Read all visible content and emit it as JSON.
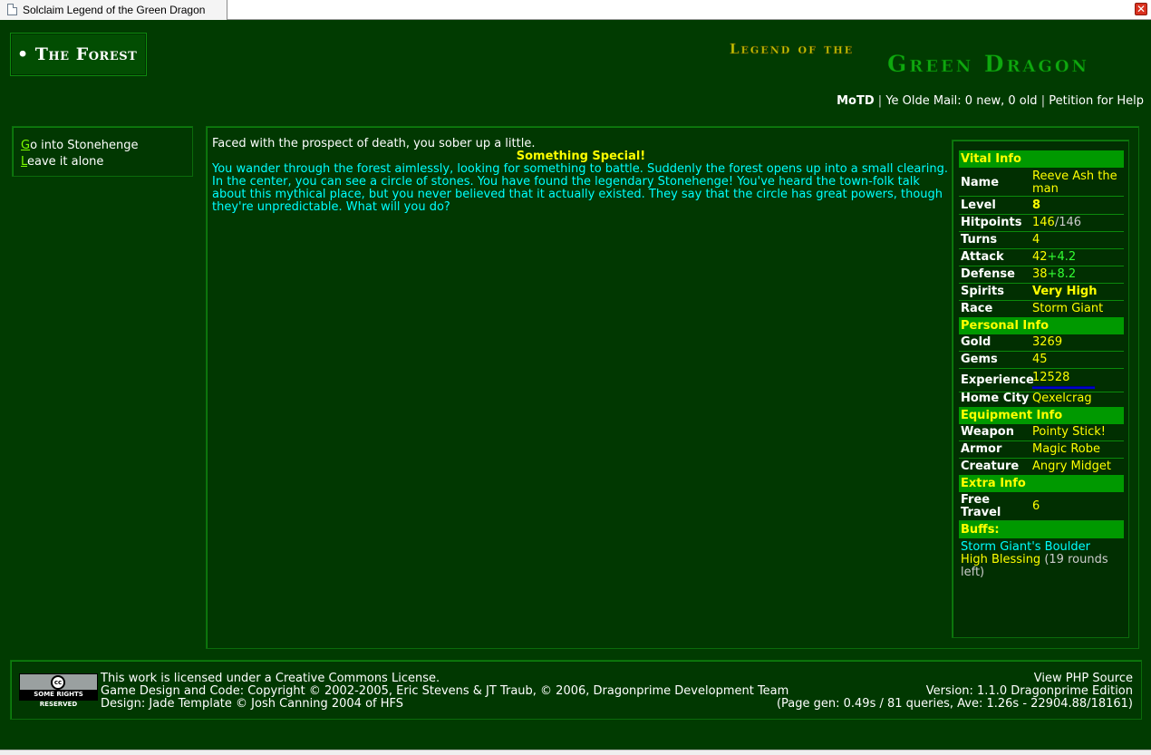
{
  "window": {
    "tab_title": "Solclaim Legend of the Green Dragon",
    "close_glyph": "✕"
  },
  "header": {
    "page_title": "• The Forest",
    "logo_text_small": "Legend of the",
    "logo_text_large": "Green Dragon",
    "logo_colors": {
      "small": "#c8c800",
      "large": "#0fa80f"
    }
  },
  "topnav": {
    "motd": "MoTD",
    "sep": "|",
    "mail": "Ye Olde Mail: 0 new, 0 old",
    "petition": "Petition for Help"
  },
  "nav": {
    "items": [
      {
        "hotkey": "G",
        "rest": "o into Stonehenge"
      },
      {
        "hotkey": "L",
        "rest": "eave it alone"
      }
    ]
  },
  "content": {
    "intro": "Faced with the prospect of death, you sober up a little.",
    "special_heading": "Something Special!",
    "story": "You wander through the forest aimlessly, looking for something to battle. Suddenly the forest opens up into a small clearing. In the center, you can see a circle of stones. You have found the legendary Stonehenge! You've heard the town-folk talk about this mythical place, but you never believed that it actually existed. They say that the circle has great powers, though they're unpredictable. What will you do?"
  },
  "stats": {
    "vital_head": "Vital Info",
    "name_label": "Name",
    "name_value": "Reeve Ash the man",
    "level_label": "Level",
    "level_value": "8",
    "hitpoints_label": "Hitpoints",
    "hp_current": "146",
    "hp_slash": "/",
    "hp_max": "146",
    "turns_label": "Turns",
    "turns_value": "4",
    "attack_label": "Attack",
    "attack_base": "42",
    "attack_bonus": "+4.2",
    "defense_label": "Defense",
    "defense_base": "38",
    "defense_bonus": "+8.2",
    "spirits_label": "Spirits",
    "spirits_value": "Very High",
    "race_label": "Race",
    "race_value": "Storm Giant",
    "personal_head": "Personal Info",
    "gold_label": "Gold",
    "gold_value": "3269",
    "gems_label": "Gems",
    "gems_value": "45",
    "experience_label": "Experience",
    "experience_value": "12528",
    "experience_progress": 0.69,
    "homecity_label": "Home City",
    "homecity_value": "Qexelcrag",
    "equipment_head": "Equipment Info",
    "weapon_label": "Weapon",
    "weapon_value": "Pointy Stick!",
    "armor_label": "Armor",
    "armor_value": "Magic Robe",
    "creature_label": "Creature",
    "creature_value": "Angry Midget",
    "extra_head": "Extra Info",
    "freetravel_label_1": "Free",
    "freetravel_label_2": "Travel",
    "freetravel_value": "6",
    "buffs_head": "Buffs:",
    "buff1": "Storm Giant's Boulder",
    "buff2": "High Blessing",
    "buff2_rounds": "(19 rounds left)"
  },
  "footer": {
    "cc_logo": "cc",
    "cc_badge_text": "SOME RIGHTS RESERVED",
    "license_prefix": "This work is licensed under a ",
    "license_link": "Creative Commons License",
    "license_suffix": ".",
    "credits": "Game Design and Code: Copyright © 2002-2005, Eric Stevens & JT Traub, © 2006, Dragonprime Development Team",
    "design": "Design: Jade Template © Josh Canning 2004 of HFS",
    "view_source": "View PHP Source",
    "version": "Version: 1.1.0 Dragonprime Edition",
    "pagegen": "(Page gen: 0.49s / 81 queries, Ave: 1.26s - 22904.88/18161)"
  }
}
